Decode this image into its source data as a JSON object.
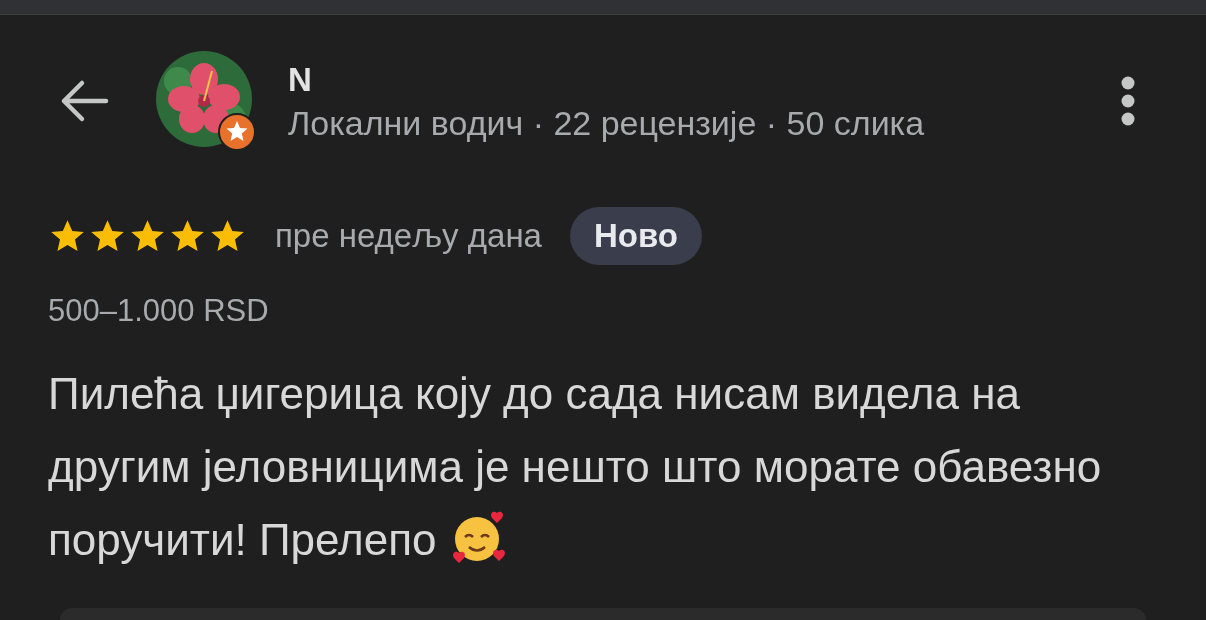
{
  "reviewer": {
    "name": "N",
    "subtitle": "Локални водич · 22 рецензије · 50 слика",
    "local_guide": true
  },
  "review": {
    "stars": 5,
    "time": "пре недељу дана",
    "badge": "Ново",
    "price": "500–1.000 RSD",
    "text": "Пилећа џигерица коју до сада нисам видела на другим јеловницима је нешто што морате обавезно поручити! Прелепо"
  }
}
